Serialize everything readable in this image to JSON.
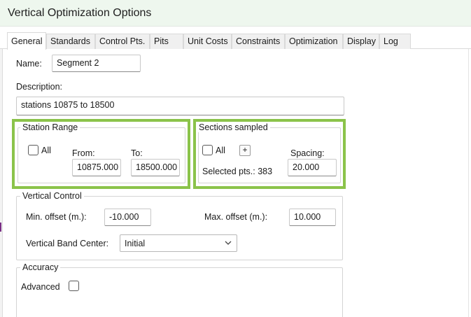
{
  "window": {
    "title": "Vertical Optimization Options"
  },
  "tabs": [
    {
      "label": "General",
      "active": true
    },
    {
      "label": "Standards",
      "active": false
    },
    {
      "label": "Control Pts.",
      "active": false
    },
    {
      "label": "Pits",
      "active": false
    },
    {
      "label": "Unit Costs",
      "active": false
    },
    {
      "label": "Constraints",
      "active": false
    },
    {
      "label": "Optimization",
      "active": false
    },
    {
      "label": "Display",
      "active": false
    },
    {
      "label": "Log",
      "active": false
    }
  ],
  "general": {
    "name_label": "Name:",
    "name_value": "Segment 2",
    "description_label": "Description:",
    "description_value": "stations 10875 to 18500"
  },
  "station_range": {
    "title": "Station Range",
    "all_label": "All",
    "all_checked": false,
    "from_label": "From:",
    "from_value": "10875.000",
    "to_label": "To:",
    "to_value": "18500.000"
  },
  "sections_sampled": {
    "title": "Sections sampled",
    "all_label": "All",
    "all_checked": false,
    "add_button": "+",
    "spacing_label": "Spacing:",
    "spacing_value": "20.000",
    "selected_pts_label": "Selected pts.: 383"
  },
  "vertical_control": {
    "title": "Vertical Control",
    "min_offset_label": "Min. offset (m.):",
    "min_offset_value": "-10.000",
    "max_offset_label": "Max. offset (m.):",
    "max_offset_value": "10.000",
    "band_center_label": "Vertical Band Center:",
    "band_center_value": "Initial"
  },
  "accuracy": {
    "title": "Accuracy",
    "advanced_label": "Advanced",
    "advanced_checked": false
  },
  "colors": {
    "highlight": "#8bc34a",
    "titlebar_bg": "#eef7ee",
    "tab_inactive_bg": "#f0f0f0"
  }
}
